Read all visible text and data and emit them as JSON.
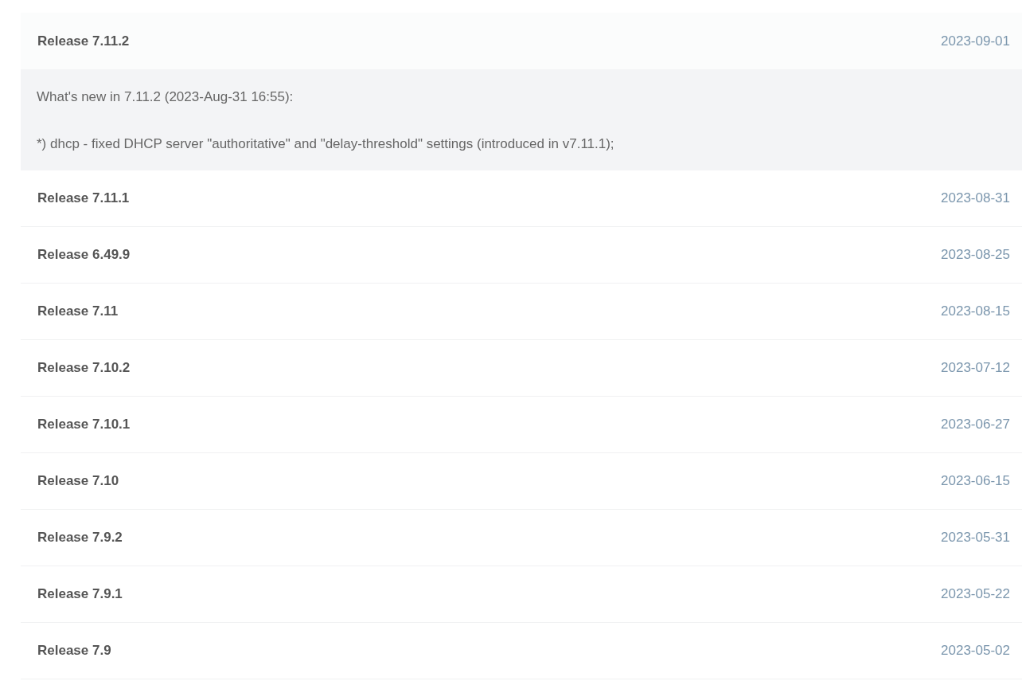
{
  "releases": [
    {
      "title": "Release 7.11.2",
      "date": "2023-09-01",
      "expanded": true,
      "notes": [
        "What's new in 7.11.2 (2023-Aug-31 16:55):",
        "*) dhcp - fixed DHCP server \"authoritative\" and \"delay-threshold\" settings (introduced in v7.11.1);"
      ]
    },
    {
      "title": "Release 7.11.1",
      "date": "2023-08-31",
      "expanded": false
    },
    {
      "title": "Release 6.49.9",
      "date": "2023-08-25",
      "expanded": false
    },
    {
      "title": "Release 7.11",
      "date": "2023-08-15",
      "expanded": false
    },
    {
      "title": "Release 7.10.2",
      "date": "2023-07-12",
      "expanded": false
    },
    {
      "title": "Release 7.10.1",
      "date": "2023-06-27",
      "expanded": false
    },
    {
      "title": "Release 7.10",
      "date": "2023-06-15",
      "expanded": false
    },
    {
      "title": "Release 7.9.2",
      "date": "2023-05-31",
      "expanded": false
    },
    {
      "title": "Release 7.9.1",
      "date": "2023-05-22",
      "expanded": false
    },
    {
      "title": "Release 7.9",
      "date": "2023-05-02",
      "expanded": false
    }
  ]
}
